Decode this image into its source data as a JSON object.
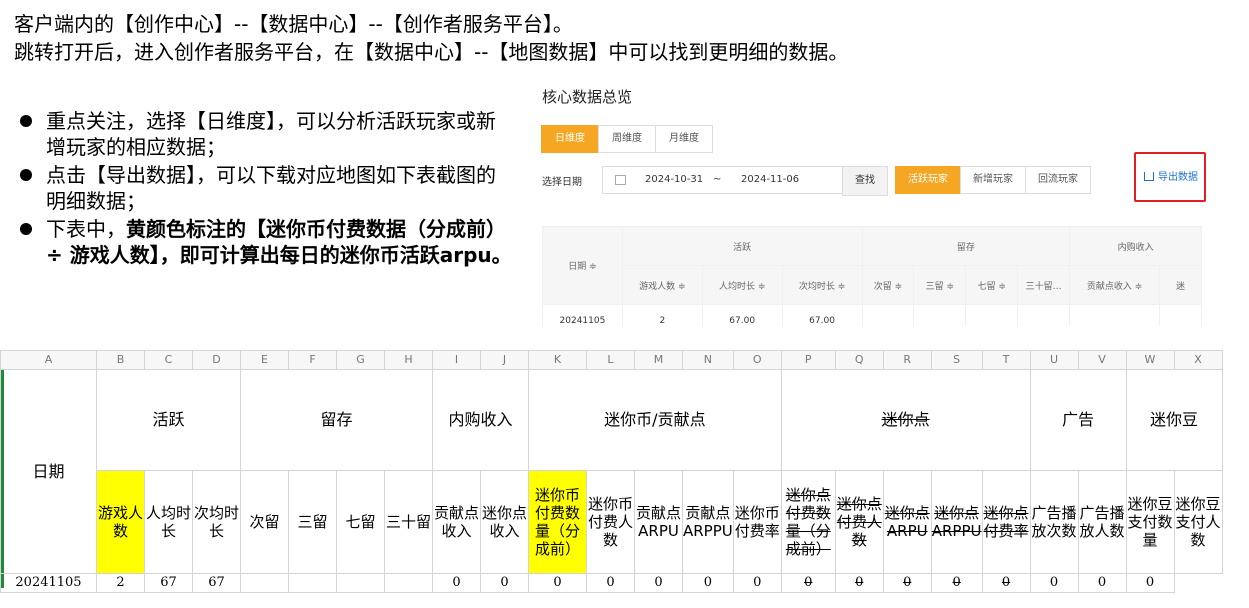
{
  "intro": {
    "line1": "客户端内的【创作中心】--【数据中心】--【创作者服务平台】。",
    "line2": "跳转打开后，进入创作者服务平台，在【数据中心】--【地图数据】中可以找到更明细的数据。"
  },
  "bullets": [
    {
      "pre": "重点关注，选择【日维度】，可以分析活跃玩家或新增玩家的相应数据；",
      "bold": ""
    },
    {
      "pre": "点击【导出数据】，可以下载对应地图如下表截图的明细数据；",
      "bold": ""
    },
    {
      "pre": "下表中，",
      "bold": "黄颜色标注的【迷你币付费数据（分成前）÷ 游戏人数】，即可计算出每日的迷你币活跃arpu。"
    }
  ],
  "panel": {
    "title": "核心数据总览",
    "dim_tabs": [
      "日维度",
      "周维度",
      "月维度"
    ],
    "active_dim": "日维度",
    "date_label": "选择日期",
    "date_start": "2024-10-31",
    "date_sep": "~",
    "date_end": "2024-11-06",
    "search_label": "查找",
    "player_tabs": [
      "活跃玩家",
      "新增玩家",
      "回流玩家"
    ],
    "active_player": "活跃玩家",
    "export_label": "导出数据",
    "table": {
      "date_header": "日期 ≑",
      "groups": [
        "活跃",
        "留存",
        "内购收入"
      ],
      "subs": [
        "游戏人数 ≑",
        "人均时长 ≑",
        "次均时长 ≑",
        "次留 ≑",
        "三留 ≑",
        "七留 ≑",
        "三十留…",
        "贡献点收入 ≑",
        "迷"
      ],
      "row": [
        "20241105",
        "2",
        "67.00",
        "67.00",
        "",
        "",
        "",
        "",
        "",
        ""
      ]
    }
  },
  "sheet": {
    "columns": [
      "A",
      "B",
      "C",
      "D",
      "E",
      "F",
      "G",
      "H",
      "I",
      "J",
      "K",
      "L",
      "M",
      "N",
      "O",
      "P",
      "Q",
      "R",
      "S",
      "T",
      "U",
      "V",
      "W",
      "X"
    ],
    "date_header": "日期",
    "groups": {
      "active": "活跃",
      "retention": "留存",
      "iap": "内购收入",
      "coin": "迷你币/贡献点",
      "point": "迷你点",
      "ads": "广告",
      "bean": "迷你豆"
    },
    "subs": {
      "players": "游戏人数",
      "avg_time": "人均时长",
      "session_time": "次均时长",
      "d2": "次留",
      "d3": "三留",
      "d7": "七留",
      "d30": "三十留",
      "contrib_income": "贡献点收入",
      "point_income": "迷你点收入",
      "coin_pay": "迷你币付费数量（分成前）",
      "coin_payers": "迷你币付费人数",
      "contrib_arpu": "贡献点ARPU",
      "contrib_arppu": "贡献点ARPPU",
      "coin_rate": "迷你币付费率",
      "pt_pay": "迷你点付费数量（分成前）",
      "pt_payers": "迷你点付费人数",
      "pt_arpu": "迷你点ARPU",
      "pt_arppu": "迷你点ARPPU",
      "pt_rate": "迷你点付费率",
      "ad_plays": "广告播放次数",
      "ad_users": "广告播放人数",
      "bean_count": "迷你豆支付数量",
      "bean_users": "迷你豆支付人数"
    },
    "row": [
      "20241105",
      "2",
      "67",
      "67",
      "",
      "",
      "",
      "",
      "0",
      "0",
      "0",
      "0",
      "0",
      "0",
      "0",
      "0",
      "0",
      "0",
      "0",
      "0",
      "0",
      "0",
      "0"
    ]
  },
  "colors": {
    "highlight": "#ffff00",
    "accent": "#f5a623",
    "export_border": "#e02020",
    "link": "#1e6fd9"
  }
}
